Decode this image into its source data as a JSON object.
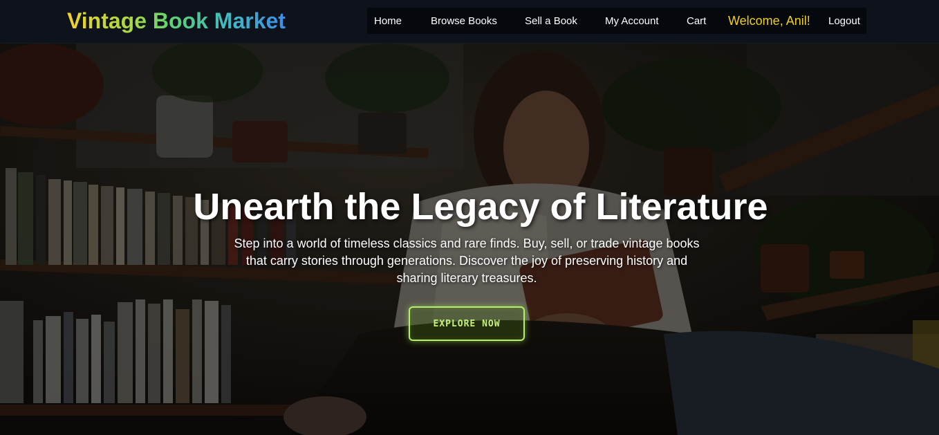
{
  "header": {
    "brand": "Vintage Book Market",
    "nav": {
      "home": "Home",
      "browse": "Browse Books",
      "sell": "Sell a Book",
      "account": "My Account",
      "cart": "Cart",
      "welcome": "Welcome, Anil!",
      "logout": "Logout"
    }
  },
  "hero": {
    "title": "Unearth the Legacy of Literature",
    "description": "Step into a world of timeless classics and rare finds. Buy, sell, or trade vintage books that carry stories through generations. Discover the joy of preserving history and sharing literary treasures.",
    "cta_label": "EXPLORE NOW",
    "background_image": "man reading an old book beside bookshelves and potted plants"
  },
  "colors": {
    "navbar": "#0d121b",
    "welcome": "#f2cf1c",
    "cta": "#b6f06a"
  }
}
